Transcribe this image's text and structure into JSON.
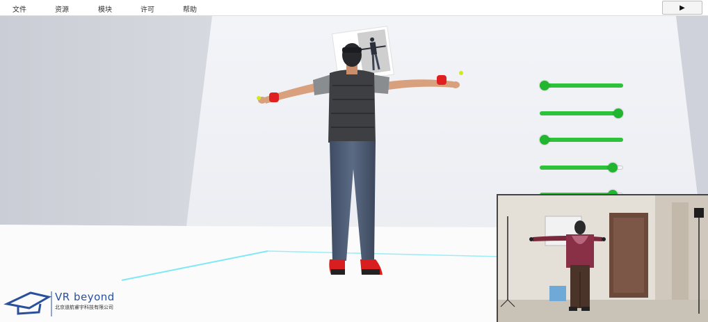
{
  "menu": {
    "items": [
      {
        "label": "文件"
      },
      {
        "label": "资源"
      },
      {
        "label": "模块"
      },
      {
        "label": "许可"
      },
      {
        "label": "帮助"
      }
    ],
    "play_label": "▶"
  },
  "sliders": [
    {
      "value": 0.0
    },
    {
      "value": 1.0
    },
    {
      "value": 0.0
    },
    {
      "value": 0.92
    },
    {
      "value": 0.92
    }
  ],
  "logo": {
    "text": "VR beyond",
    "subtitle": "北京道航睿宇科技有限公司"
  },
  "colors": {
    "slider_green": "#22b52f",
    "logo_blue": "#2a4f9b",
    "floor_line": "#7ee8f5"
  }
}
